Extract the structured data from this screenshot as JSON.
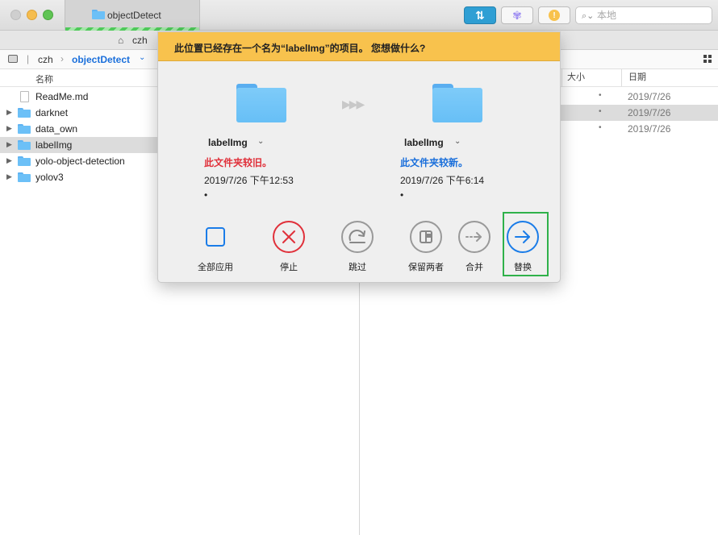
{
  "window": {
    "tab_title": "objectDetect",
    "sync_icon": "⇅",
    "spin_icon": "✾",
    "info_icon": "!",
    "search_placeholder": "本地",
    "tabrow_label": "czh"
  },
  "pathbar": {
    "crumbs": [
      "czh",
      "objectDetect"
    ],
    "separator": "›",
    "chevron": "⌄"
  },
  "left_panel": {
    "column_name": "名称",
    "files": [
      {
        "name": "ReadMe.md",
        "type": "file",
        "selected": false
      },
      {
        "name": "darknet",
        "type": "folder",
        "selected": false
      },
      {
        "name": "data_own",
        "type": "folder",
        "selected": false
      },
      {
        "name": "labelImg",
        "type": "folder",
        "selected": true
      },
      {
        "name": "yolo-object-detection",
        "type": "folder",
        "selected": false
      },
      {
        "name": "yolov3",
        "type": "folder",
        "selected": false
      }
    ]
  },
  "right_panel": {
    "column_size": "大小",
    "column_date": "日期",
    "rows": [
      {
        "size": "•",
        "date": "2019/7/26",
        "selected": false
      },
      {
        "size": "•",
        "date": "2019/7/26",
        "selected": true
      },
      {
        "size": "•",
        "date": "2019/7/26",
        "selected": false
      }
    ]
  },
  "dialog": {
    "title": "此位置已经存在一个名为“labelImg”的项目。 您想做什么?",
    "left": {
      "name": "labelImg",
      "status": "此文件夹较旧。",
      "date": "2019/7/26 下午12:53",
      "bullet": "•"
    },
    "right": {
      "name": "labelImg",
      "status": "此文件夹较新。",
      "date": "2019/7/26 下午6:14",
      "bullet": "•"
    },
    "arrows": "▶▶▶",
    "actions": {
      "apply_all": "全部应用",
      "stop": "停止",
      "skip": "跳过",
      "keep_both": "保留两者",
      "merge": "合并",
      "replace": "替换"
    }
  },
  "colors": {
    "accent": "#1a6fdb",
    "warning_header": "#f8c24d",
    "older": "#e0303a",
    "highlight_frame": "#2fb14a"
  }
}
